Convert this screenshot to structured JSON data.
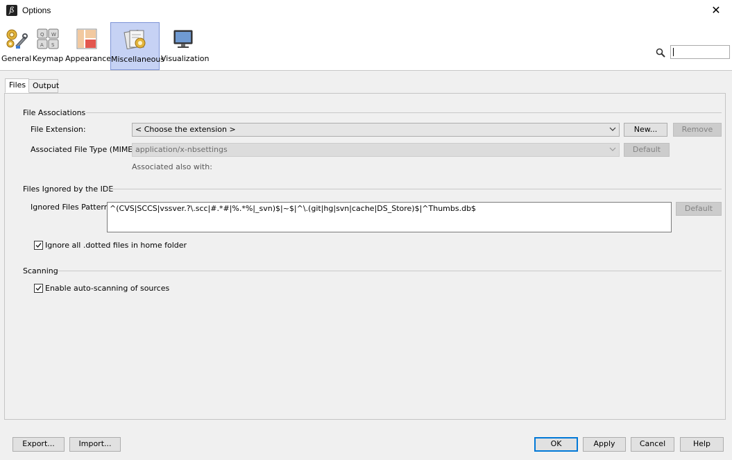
{
  "window": {
    "title": "Options",
    "close_glyph": "✕"
  },
  "categories": [
    {
      "label": "General",
      "icon": "gears-wrench-icon"
    },
    {
      "label": "Keymap",
      "icon": "keyboard-keys-icon"
    },
    {
      "label": "Appearance",
      "icon": "layout-panels-icon"
    },
    {
      "label": "Miscellaneous",
      "icon": "misc-cards-icon",
      "selected": true
    },
    {
      "label": "Visualization",
      "icon": "monitor-icon"
    }
  ],
  "search": {
    "icon": "search-icon",
    "value": ""
  },
  "tabs": [
    {
      "label": "Files",
      "active": true
    },
    {
      "label": "Output",
      "active": false
    }
  ],
  "file_associations": {
    "title": "File Associations",
    "extension_label": "File Extension:",
    "extension_value": "< Choose the extension >",
    "new_button": "New...",
    "remove_button": "Remove",
    "mime_label": "Associated File Type (MIME):",
    "mime_value": "application/x-nbsettings",
    "default_button": "Default",
    "also_with_label": "Associated also with:"
  },
  "files_ignored": {
    "title": "Files Ignored by the IDE",
    "pattern_label": "Ignored Files Pattern:",
    "pattern_value": "^(CVS|SCCS|vssver.?\\.scc|#.*#|%.*%|_svn)$|~$|^\\.(git|hg|svn|cache|DS_Store)$|^Thumbs.db$",
    "default_button": "Default",
    "dotted_checkbox_label": "Ignore all .dotted files in home folder",
    "dotted_checked": true
  },
  "scanning": {
    "title": "Scanning",
    "auto_scan_label": "Enable auto-scanning of sources",
    "auto_scan_checked": true
  },
  "footer": {
    "export_button": "Export...",
    "import_button": "Import...",
    "ok_button": "OK",
    "apply_button": "Apply",
    "cancel_button": "Cancel",
    "help_button": "Help"
  },
  "colors": {
    "selected_category_bg": "#c6d2f4",
    "selected_category_border": "#7d94d6",
    "primary_button_border": "#0078d7"
  }
}
